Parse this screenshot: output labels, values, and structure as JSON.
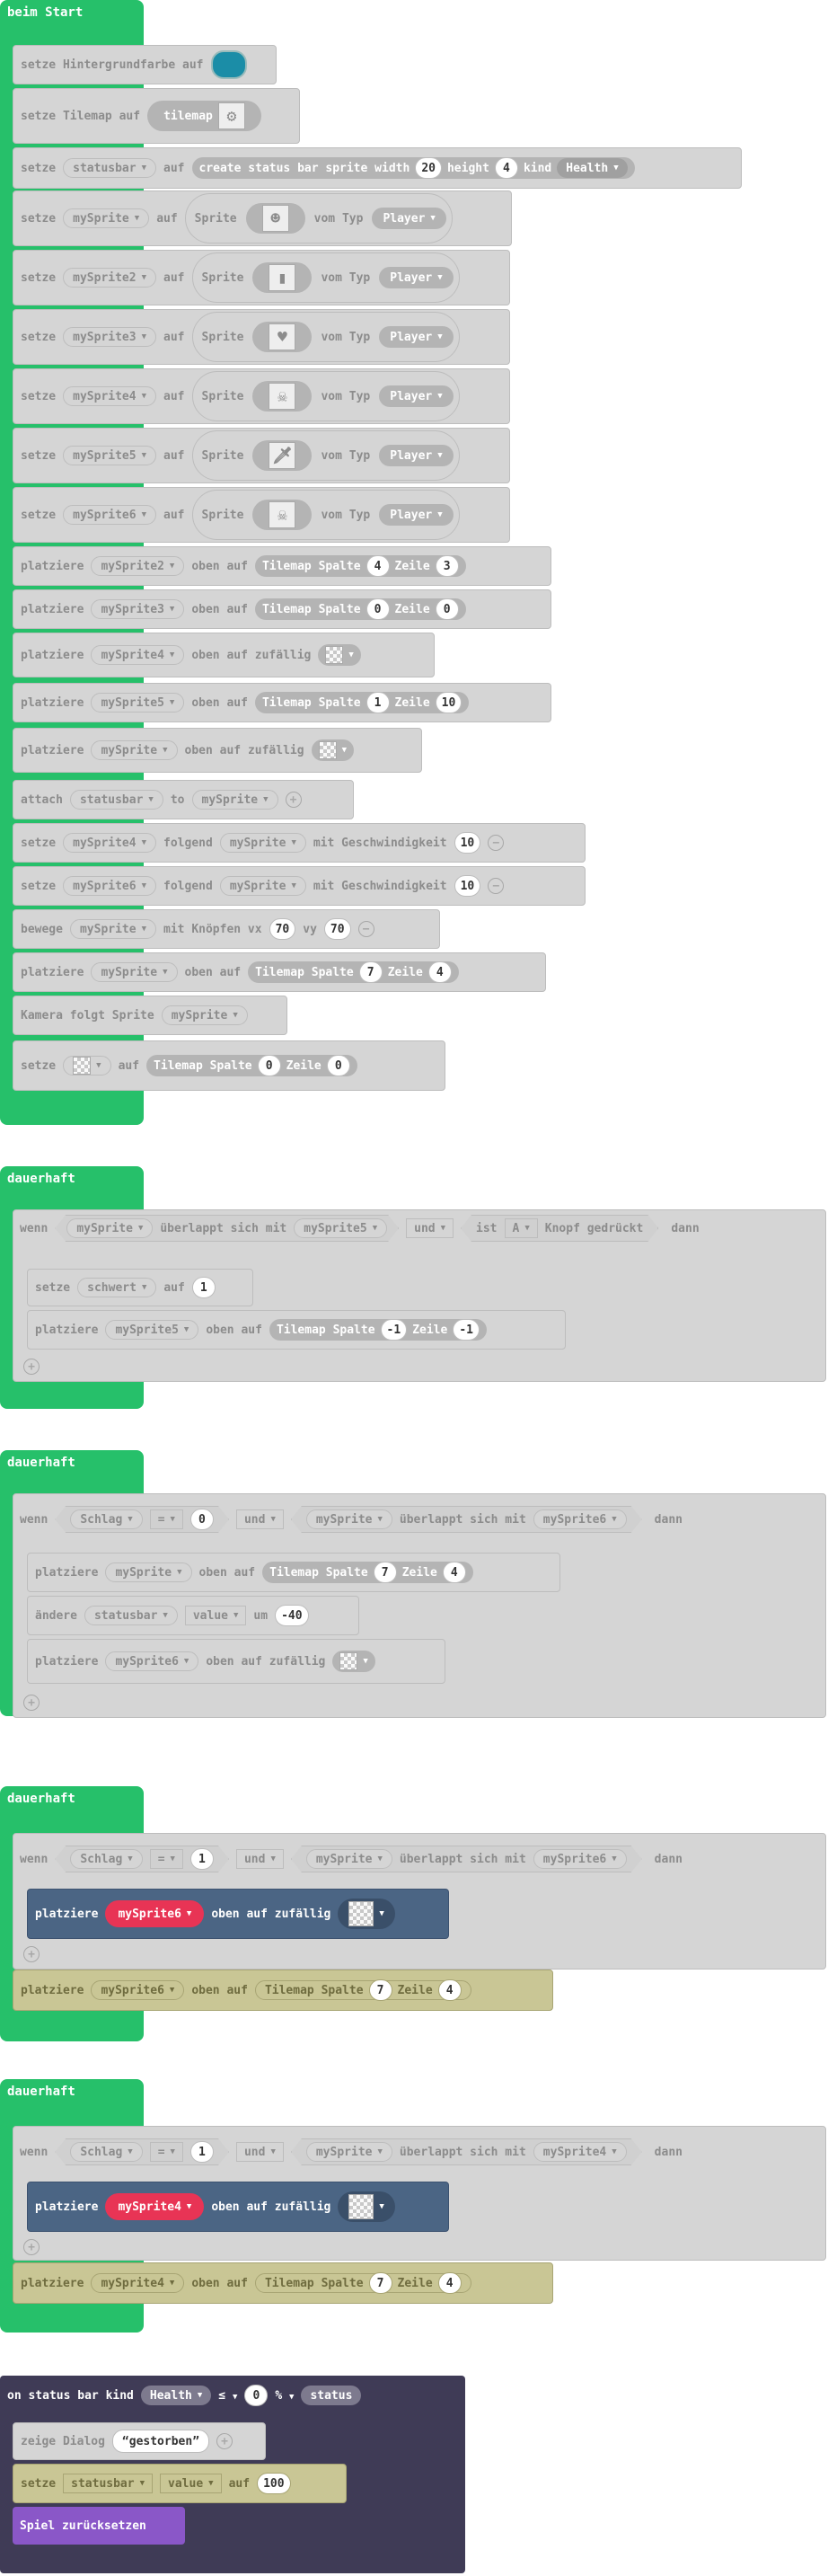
{
  "colors": {
    "hat_green": "#26c06a",
    "disabled_gray": "#d5d5d5",
    "active_blue": "#4b6584",
    "sprite_red": "#e83455",
    "olive": "#c9c695",
    "status_dark": "#3f3b56",
    "purple": "#8a57c8",
    "bg_teal": "#1b8da7"
  },
  "icons": {
    "tilemap": "tilemap-icon",
    "player": "player-sprite-icon",
    "sword": "sword-sprite-icon",
    "skull": "skull-sprite-icon",
    "heart": "heart-sprite-icon",
    "checker": "transparent-tile-icon"
  },
  "start": {
    "title": "beim Start",
    "bg": {
      "t1": "setze Hintergrundfarbe auf"
    },
    "tilemap": {
      "t1": "setze Tilemap auf",
      "t2": "tilemap"
    },
    "status": {
      "t1": "setze",
      "var": "statusbar",
      "t2": "auf",
      "t3": "create status bar sprite width",
      "w": "20",
      "t4": "height",
      "h": "4",
      "t5": "kind",
      "kind": "Health"
    },
    "sprites": [
      {
        "set": "setze",
        "var": "mySprite",
        "auf": "auf",
        "spr": "Sprite",
        "vom": "vom Typ",
        "typ": "Player",
        "icon": "☻"
      },
      {
        "set": "setze",
        "var": "mySprite2",
        "auf": "auf",
        "spr": "Sprite",
        "vom": "vom Typ",
        "typ": "Player",
        "icon": "▮"
      },
      {
        "set": "setze",
        "var": "mySprite3",
        "auf": "auf",
        "spr": "Sprite",
        "vom": "vom Typ",
        "typ": "Player",
        "icon": "♥"
      },
      {
        "set": "setze",
        "var": "mySprite4",
        "auf": "auf",
        "spr": "Sprite",
        "vom": "vom Typ",
        "typ": "Player",
        "icon": "☠"
      },
      {
        "set": "setze",
        "var": "mySprite5",
        "auf": "auf",
        "spr": "Sprite",
        "vom": "vom Typ",
        "typ": "Player",
        "icon": "🗡"
      },
      {
        "set": "setze",
        "var": "mySprite6",
        "auf": "auf",
        "spr": "Sprite",
        "vom": "vom Typ",
        "typ": "Player",
        "icon": "☠"
      }
    ],
    "place2": {
      "t1": "platziere",
      "var": "mySprite2",
      "t2": "oben auf",
      "t3": "Tilemap Spalte",
      "c": "4",
      "t4": "Zeile",
      "r": "3"
    },
    "place3": {
      "t1": "platziere",
      "var": "mySprite3",
      "t2": "oben auf",
      "t3": "Tilemap Spalte",
      "c": "0",
      "t4": "Zeile",
      "r": "0"
    },
    "place4": {
      "t1": "platziere",
      "var": "mySprite4",
      "t2": "oben auf zufällig"
    },
    "place5": {
      "t1": "platziere",
      "var": "mySprite5",
      "t2": "oben auf",
      "t3": "Tilemap Spalte",
      "c": "1",
      "t4": "Zeile",
      "r": "10"
    },
    "placeP": {
      "t1": "platziere",
      "var": "mySprite",
      "t2": "oben auf zufällig"
    },
    "attach": {
      "t1": "attach",
      "var": "statusbar",
      "t2": "to",
      "var2": "mySprite"
    },
    "follow4": {
      "t1": "setze",
      "var": "mySprite4",
      "t2": "folgend",
      "var2": "mySprite",
      "t3": "mit Geschwindigkeit",
      "v": "10"
    },
    "follow6": {
      "t1": "setze",
      "var": "mySprite6",
      "t2": "folgend",
      "var2": "mySprite",
      "t3": "mit Geschwindigkeit",
      "v": "10"
    },
    "move": {
      "t1": "bewege",
      "var": "mySprite",
      "t2": "mit Knöpfen vx",
      "vx": "70",
      "t3": "vy",
      "vy": "70"
    },
    "placeP2": {
      "t1": "platziere",
      "var": "mySprite",
      "t2": "oben auf",
      "t3": "Tilemap Spalte",
      "c": "7",
      "t4": "Zeile",
      "r": "4"
    },
    "camera": {
      "t1": "Kamera folgt Sprite",
      "var": "mySprite"
    },
    "settile": {
      "t1": "setze",
      "t2": "auf",
      "t3": "Tilemap Spalte",
      "c": "0",
      "t4": "Zeile",
      "r": "0"
    }
  },
  "forever1": {
    "title": "dauerhaft",
    "wenn": "wenn",
    "a": "mySprite",
    "ov": "überlappt sich mit",
    "b": "mySprite5",
    "und": "und",
    "ist": "ist",
    "btn": "A",
    "knopf": "Knopf gedrückt",
    "dann": "dann",
    "s1": {
      "t1": "setze",
      "var": "schwert",
      "t2": "auf",
      "v": "1"
    },
    "s2": {
      "t1": "platziere",
      "var": "mySprite5",
      "t2": "oben auf",
      "t3": "Tilemap Spalte",
      "c": "-1",
      "t4": "Zeile",
      "r": "-1"
    }
  },
  "forever2": {
    "title": "dauerhaft",
    "wenn": "wenn",
    "v": "Schlag",
    "op": "=",
    "n": "0",
    "und": "und",
    "a": "mySprite",
    "ov": "überlappt sich mit",
    "b": "mySprite6",
    "dann": "dann",
    "s1": {
      "t1": "platziere",
      "var": "mySprite",
      "t2": "oben auf",
      "t3": "Tilemap Spalte",
      "c": "7",
      "t4": "Zeile",
      "r": "4"
    },
    "s2": {
      "t1": "ändere",
      "var": "statusbar",
      "prop": "value",
      "t2": "um",
      "v": "-40"
    },
    "s3": {
      "t1": "platziere",
      "var": "mySprite6",
      "t2": "oben auf zufällig"
    }
  },
  "forever3": {
    "title": "dauerhaft",
    "wenn": "wenn",
    "v": "Schlag",
    "op": "=",
    "n": "1",
    "und": "und",
    "a": "mySprite",
    "ov": "überlappt sich mit",
    "b": "mySprite6",
    "dann": "dann",
    "s1": {
      "t1": "platziere",
      "var": "mySprite6",
      "t2": "oben auf zufällig"
    },
    "after": {
      "t1": "platziere",
      "var": "mySprite6",
      "t2": "oben auf",
      "t3": "Tilemap Spalte",
      "c": "7",
      "t4": "Zeile",
      "r": "4"
    }
  },
  "forever4": {
    "title": "dauerhaft",
    "wenn": "wenn",
    "v": "Schlag",
    "op": "=",
    "n": "1",
    "und": "und",
    "a": "mySprite",
    "ov": "überlappt sich mit",
    "b": "mySprite4",
    "dann": "dann",
    "s1": {
      "t1": "platziere",
      "var": "mySprite4",
      "t2": "oben auf zufällig"
    },
    "after": {
      "t1": "platziere",
      "var": "mySprite4",
      "t2": "oben auf",
      "t3": "Tilemap Spalte",
      "c": "7",
      "t4": "Zeile",
      "r": "4"
    }
  },
  "statusEvt": {
    "t1": "on status bar kind",
    "kind": "Health",
    "cmp": "≤",
    "n": "0",
    "pct": "%",
    "t2": "status",
    "dlg": {
      "t1": "zeige Dialog",
      "str": "gestorben"
    },
    "set": {
      "t1": "setze",
      "var": "statusbar",
      "prop": "value",
      "t2": "auf",
      "v": "100"
    },
    "reset": "Spiel zurücksetzen"
  }
}
